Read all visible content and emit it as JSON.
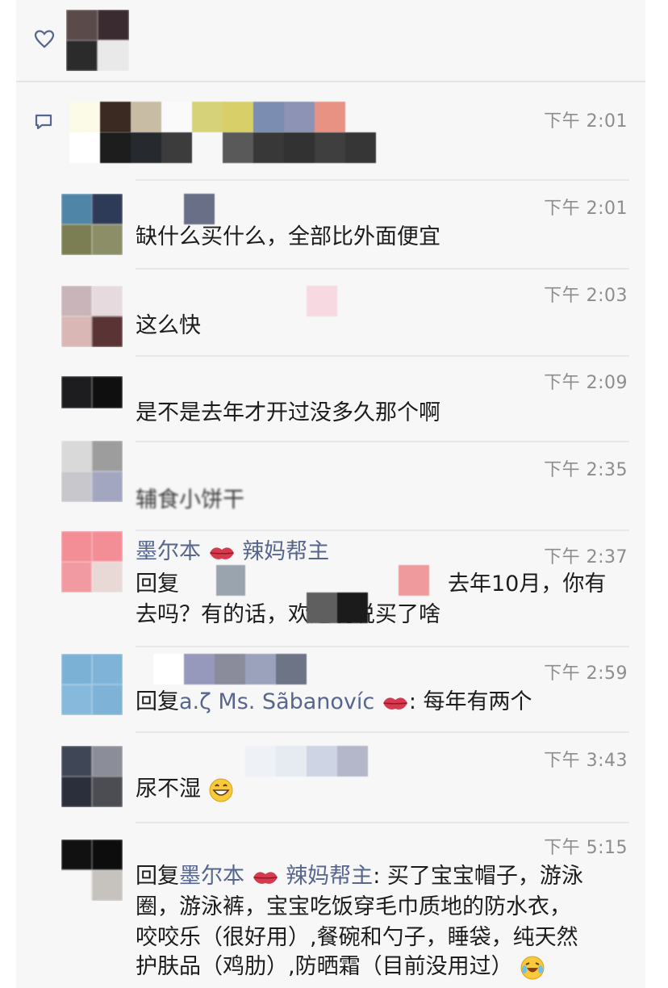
{
  "likes": {
    "heart_icon": "heart-icon"
  },
  "comments": [
    {
      "time": "下午 2:01",
      "text": ""
    },
    {
      "time": "下午 2:01",
      "text": "缺什么买什么，全部比外面便宜"
    },
    {
      "time": "下午 2:03",
      "text": "这么快"
    },
    {
      "time": "下午 2:09",
      "text": "是不是去年才开过没多久那个啊"
    },
    {
      "time": "下午 2:35",
      "text": "辅食小饼干"
    },
    {
      "time": "下午 2:37",
      "name": "墨尔本",
      "name_suffix": "辣妈帮主",
      "reply_prefix": "回复",
      "line1_tail": "去年10月，你有",
      "line2": "去吗？有的话，欢迎说说买了啥"
    },
    {
      "time": "下午 2:59",
      "reply_prefix": "回复",
      "reply_to": "a.ζ Ms. Sãbanovíc",
      "body": ": 每年有两个"
    },
    {
      "time": "下午 3:43",
      "text": "尿不湿"
    },
    {
      "time": "下午 5:15",
      "reply_prefix": "回复",
      "reply_to": "墨尔本",
      "reply_to_suffix": "辣妈帮主",
      "body_line1": ": 买了宝宝帽子，游泳",
      "body_line2": "圈，游泳裤，宝宝吃饭穿毛巾质地的防水衣，",
      "body_line3": "咬咬乐（很好用）,餐碗和勺子，睡袋，纯天然",
      "body_line4": "护肤品（鸡肋）,防晒霜（目前没用过）"
    }
  ],
  "colors": {
    "time": "#8d8d8d",
    "name": "#56668e",
    "text": "#1c1c1c"
  }
}
